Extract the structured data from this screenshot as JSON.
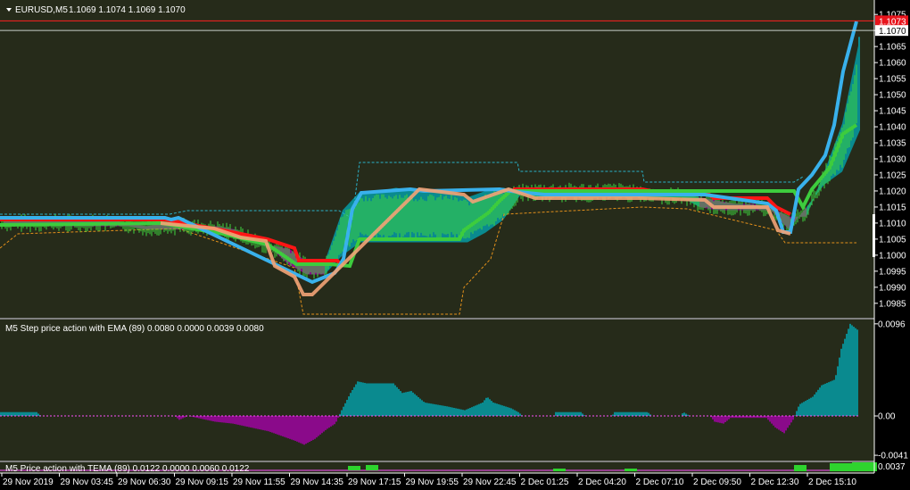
{
  "chart_window": {
    "symbol_title": "EURUSD,M5",
    "ohlc": "1.1069 1.1074 1.1069 1.1070",
    "bid_tag": "1.1070",
    "ask_tag": "1.1073",
    "price_ticks": [
      "1.1075",
      "1.1070",
      "1.1065",
      "1.1060",
      "1.1055",
      "1.1050",
      "1.1045",
      "1.1040",
      "1.1035",
      "1.1030",
      "1.1025",
      "1.1020",
      "1.1015",
      "1.1010",
      "1.1005",
      "1.1000",
      "1.0995",
      "1.0990",
      "1.0985"
    ],
    "price_tick_values": [
      1.1075,
      1.107,
      1.1065,
      1.106,
      1.1055,
      1.105,
      1.1045,
      1.104,
      1.1035,
      1.103,
      1.1025,
      1.102,
      1.1015,
      1.101,
      1.1005,
      1.1,
      1.0995,
      1.099,
      1.0985
    ],
    "price_ylim": [
      1.09805,
      1.10795
    ],
    "bid_value": 1.107,
    "ask_value": 1.1073
  },
  "indicator_1": {
    "title": "M5 Step price action with EMA (89) 0.0080 0.0000 0.0039 0.0080",
    "ticks": [
      "0.0096",
      "0.00",
      "-0.0041"
    ],
    "tick_values": [
      0.0096,
      0.0,
      -0.0041
    ],
    "ylim": [
      -0.00465,
      0.01005
    ]
  },
  "indicator_2": {
    "title": "M5 Price action with TEMA (89) 0.0122 0.0000 0.0060 0.0122",
    "ticks": [
      "0.0037"
    ]
  },
  "time_axis": {
    "labels": [
      "29 Nov 2019",
      "29 Nov 03:45",
      "29 Nov 06:30",
      "29 Nov 09:15",
      "29 Nov 11:55",
      "29 Nov 14:35",
      "29 Nov 17:15",
      "29 Nov 19:55",
      "29 Nov 22:45",
      "2 Dec 01:25",
      "2 Dec 04:20",
      "2 Dec 07:10",
      "2 Dec 09:50",
      "2 Dec 12:30",
      "2 Dec 15:10"
    ]
  },
  "colors": {
    "background": "#262b1a",
    "bars": "#3ed63e",
    "cyan_line": "#39b1ec",
    "salmon_line": "#f3a377",
    "red_line": "#ff1515",
    "green_line": "#3dcc3d",
    "teal_fill": "#0a8a8f",
    "purple_fill": "#8a0a8a",
    "dashed_cyan": "#2ab0c8",
    "dashed_orange": "#e3901a",
    "zero_line": "#ff4fff"
  },
  "chart_data": {
    "type": "line",
    "title": "EURUSD,M5",
    "x": [
      0,
      20,
      40,
      60,
      80,
      100,
      120,
      140,
      160,
      180,
      200,
      220,
      240,
      260,
      280,
      300,
      320,
      340,
      360,
      380,
      400,
      420,
      440,
      460,
      480,
      500,
      520,
      540,
      560,
      580,
      600,
      620,
      640,
      660,
      680,
      700,
      720,
      740,
      760,
      780,
      800,
      820,
      840,
      860,
      880,
      900,
      920,
      940,
      960
    ],
    "series": [
      {
        "role": "upper_step",
        "values": [
          1.1011,
          1.1011,
          1.1011,
          1.1011,
          1.1011,
          1.1011,
          1.1011,
          1.101,
          1.1009,
          1.101,
          1.101,
          1.1009,
          1.1009,
          1.1008,
          1.1005,
          1.1003,
          1.1002,
          1.0998,
          1.0998,
          1.1014,
          1.102,
          1.102,
          1.1021,
          1.102,
          1.102,
          1.102,
          1.1018,
          1.102,
          1.1021,
          1.102,
          1.1021,
          1.1021,
          1.1021,
          1.1021,
          1.1021,
          1.1021,
          1.1019,
          1.1019,
          1.1019,
          1.1018,
          1.1017,
          1.1016,
          1.1016,
          1.1015,
          1.1012,
          1.1012,
          1.1026,
          1.1041,
          1.1068
        ]
      },
      {
        "role": "lower_step",
        "values": [
          1.1009,
          1.1009,
          1.1009,
          1.1009,
          1.1009,
          1.1009,
          1.1009,
          1.1009,
          1.1008,
          1.1008,
          1.1008,
          1.1008,
          1.1007,
          1.1006,
          1.1004,
          1.1002,
          1.0997,
          1.0994,
          1.0994,
          1.1,
          1.1004,
          1.1004,
          1.1004,
          1.1004,
          1.1004,
          1.1004,
          1.1004,
          1.1007,
          1.1011,
          1.1019,
          1.1018,
          1.1018,
          1.1018,
          1.1018,
          1.1018,
          1.1018,
          1.1018,
          1.1018,
          1.1018,
          1.1015,
          1.1014,
          1.1014,
          1.1014,
          1.1014,
          1.1008,
          1.1015,
          1.1022,
          1.1026,
          1.1039
        ]
      }
    ],
    "ylim": [
      1.09805,
      1.10795
    ]
  }
}
